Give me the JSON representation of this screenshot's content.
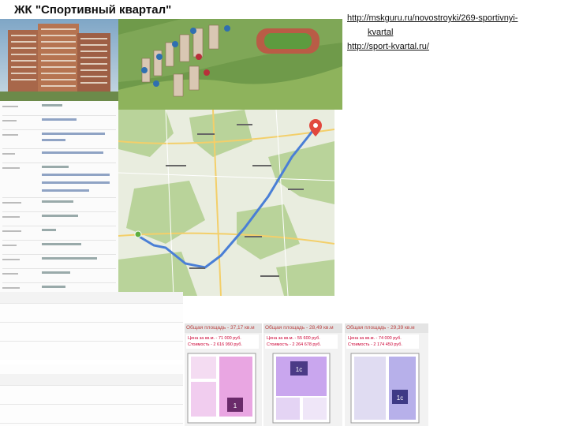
{
  "page": {
    "title": "ЖК \"Спортивный квартал\""
  },
  "links": [
    {
      "line1": "http://mskguru.ru/novostroyki/269-sportivnyi-",
      "line2": "kvartal"
    },
    {
      "line1": "http://sport-kvartal.ru/"
    }
  ],
  "plans": [
    {
      "area": "Общая площадь - 37,17 кв.м",
      "price_sqm": "Цена за кв.м. - 71 000 руб.",
      "total": "Стоимость - 2 616 990 руб.",
      "rooms_badge": "1",
      "color": "#d77ad0"
    },
    {
      "area": "Общая площадь - 28,49 кв.м",
      "price_sqm": "Цена за кв.м. - 55 600 руб.",
      "total": "Стоимость - 2 264 678 руб.",
      "rooms_badge": "1с",
      "color": "#a776d4"
    },
    {
      "area": "Общая площадь - 29,39 кв.м",
      "price_sqm": "Цена за кв.м. - 74 000 руб.",
      "total": "Стоимость - 2 174 450 руб.",
      "rooms_badge": "1с",
      "color": "#8b7fd9"
    }
  ],
  "colors": {
    "map_bg": "#e9eddf",
    "route": "#4a7fd6",
    "forest": "#b9d39a",
    "price_text": "#cc0033"
  },
  "icons": [
    "map-pin-icon",
    "start-marker-icon"
  ]
}
